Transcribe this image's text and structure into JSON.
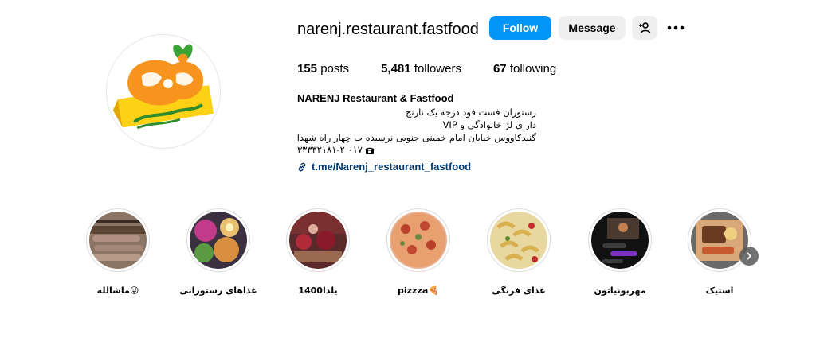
{
  "profile": {
    "username": "narenj.restaurant.fastfood",
    "avatar_icon": "narenj-logo",
    "follow_label": "Follow",
    "message_label": "Message",
    "add_user_icon": "person-plus-icon",
    "more_icon": "ellipsis-icon",
    "stats": {
      "posts_count": "155",
      "posts_label": "posts",
      "followers_count": "5,481",
      "followers_label": "followers",
      "following_count": "67",
      "following_label": "following"
    },
    "bio": {
      "name": "NARENJ Restaurant & Fastfood",
      "lines": [
        "رستوران فست فود درجه یک نارنج",
        "دارای لژ خانوادگی و VIP",
        "گنبدکاووس خیابان امام خمینی جنوبی نرسیده ب چهار راه شهدا"
      ],
      "phone": "۰۱۷ ۳۳۳۳۲۱۸۱-۲",
      "phone_icon": "telephone-icon",
      "link": "t.me/Narenj_restaurant_fastfood",
      "link_icon": "link-icon"
    }
  },
  "highlights": [
    {
      "label": "ماشالله😜",
      "icon": "kebab-photo"
    },
    {
      "label": "غذاهای رستورانی",
      "icon": "dishes-photo"
    },
    {
      "label": "یلدا1400",
      "icon": "yalda-photo"
    },
    {
      "label": "pizzza🍕",
      "icon": "pizza-photo"
    },
    {
      "label": "غذای فرنگی",
      "icon": "pasta-photo"
    },
    {
      "label": "مهربونیاتون",
      "icon": "chat-screenshot-photo"
    },
    {
      "label": "استیک",
      "icon": "steak-photo"
    }
  ],
  "next_icon": "chevron-right-icon",
  "colors": {
    "follow_bg": "#0095f6",
    "secondary_btn_bg": "#efefef",
    "link": "#00376b",
    "logo_orange": "#f7941d",
    "logo_yellow": "#fcd116",
    "logo_green": "#3aa335"
  }
}
